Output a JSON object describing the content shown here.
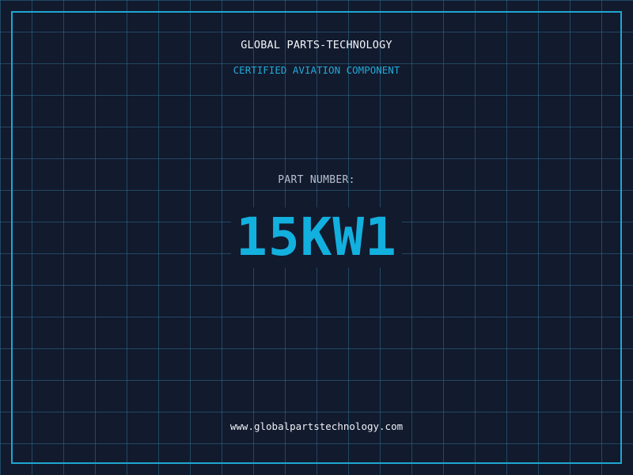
{
  "header": {
    "company": "GLOBAL PARTS-TECHNOLOGY",
    "subtitle": "CERTIFIED AVIATION COMPONENT"
  },
  "part": {
    "label": "PART NUMBER:",
    "number": "15KW1"
  },
  "footer": {
    "website": "www.globalpartstechnology.com"
  },
  "colors": {
    "background": "#121a2e",
    "grid": "#2d6e8c",
    "accent": "#1ea6d0",
    "text_primary": "#f2f4f7",
    "text_muted": "#b7c0cc"
  }
}
